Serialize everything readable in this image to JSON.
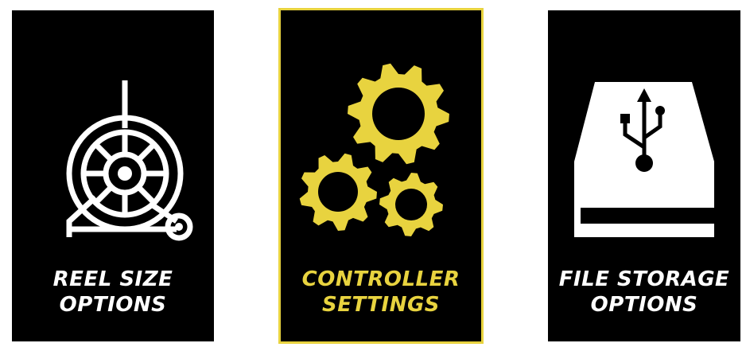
{
  "colors": {
    "background": "#000000",
    "frame": "#ffffff",
    "default_border": "#ffffff",
    "selected_accent": "#e8d33f"
  },
  "menu": {
    "selected_index": 1,
    "tiles": [
      {
        "icon": "cable-reel-icon",
        "label_line1": "REEL SIZE",
        "label_line2": "OPTIONS"
      },
      {
        "icon": "gears-icon",
        "label_line1": "CONTROLLER",
        "label_line2": "SETTINGS"
      },
      {
        "icon": "usb-drive-icon",
        "label_line1": "FILE STORAGE",
        "label_line2": "OPTIONS"
      }
    ]
  }
}
